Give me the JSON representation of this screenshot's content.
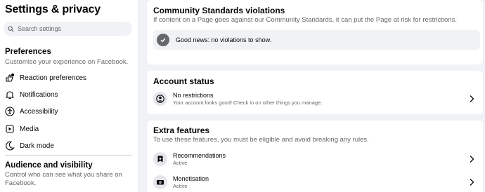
{
  "sidebar": {
    "title": "Settings & privacy",
    "search_placeholder": "Search settings",
    "preferences": {
      "title": "Preferences",
      "subtitle": "Customise your experience on Facebook.",
      "items": [
        {
          "label": "Reaction preferences",
          "icon": "reaction-icon"
        },
        {
          "label": "Notifications",
          "icon": "bell-icon"
        },
        {
          "label": "Accessibility",
          "icon": "accessibility-icon"
        },
        {
          "label": "Media",
          "icon": "media-icon"
        },
        {
          "label": "Dark mode",
          "icon": "moon-icon"
        }
      ]
    },
    "audience": {
      "title": "Audience and visibility",
      "subtitle": "Control who can see what you share on Facebook."
    }
  },
  "violations": {
    "title": "Community Standards violations",
    "subtitle": "If content on a Page goes against our Community Standards, it can put the Page at risk for restrictions.",
    "status_text": "Good news: no violations to show.",
    "status_icon": "check-circle-icon"
  },
  "account_status": {
    "title": "Account status",
    "row_title": "No restrictions",
    "row_subtitle": "Your account looks good! Check in on other things you manage.",
    "row_icon": "account-icon"
  },
  "extra_features": {
    "title": "Extra features",
    "subtitle": "To use these features, you must be eligible and avoid breaking any rules.",
    "items": [
      {
        "title": "Recommendations",
        "status": "Active",
        "icon": "recommendations-icon"
      },
      {
        "title": "Monetisation",
        "status": "Active",
        "icon": "monetisation-icon"
      }
    ]
  }
}
